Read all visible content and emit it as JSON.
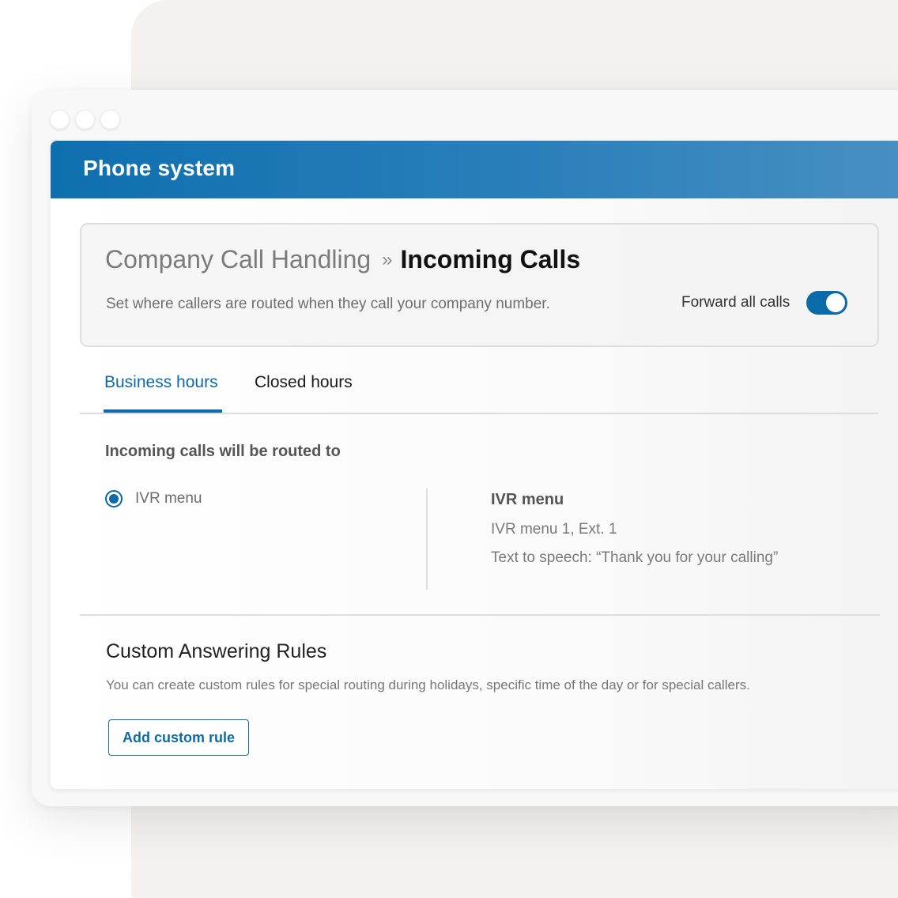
{
  "app": {
    "title": "Phone system"
  },
  "header_card": {
    "breadcrumb_parent": "Company Call Handling",
    "breadcrumb_separator": "»",
    "breadcrumb_current": "Incoming Calls",
    "description": "Set where callers are routed when they call your company number.",
    "forward_label": "Forward all calls",
    "forward_enabled": true
  },
  "tabs": [
    {
      "label": "Business hours",
      "active": true
    },
    {
      "label": "Closed hours",
      "active": false
    }
  ],
  "routing": {
    "title": "Incoming calls will be routed to",
    "option_label": "IVR menu",
    "option_selected": true,
    "detail_title": "IVR menu",
    "detail_line1": "IVR menu 1, Ext. 1",
    "detail_line2": "Text to speech: “Thank you for your calling”"
  },
  "custom_rules": {
    "title": "Custom Answering Rules",
    "description": "You can create custom rules for special routing during holidays, specific time of the day or for special callers.",
    "button_label": "Add custom rule"
  },
  "colors": {
    "accent": "#0e6aa8",
    "header_start": "#0e6fae",
    "header_end": "#4990c2"
  }
}
